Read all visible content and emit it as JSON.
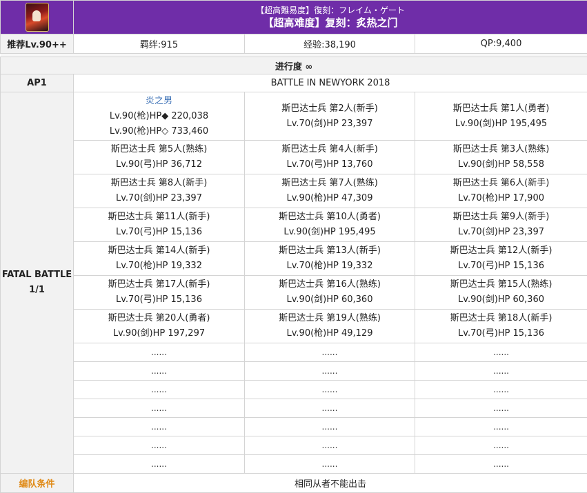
{
  "quest": {
    "title_jp": "【超高難易度】復刻：フレイム・ゲート",
    "title_cn": "【超高难度】复刻：炙热之门",
    "portrait_icon": "servant-portrait-icon"
  },
  "rewards": {
    "recommend_label": "推荐Lv.90++",
    "bond": "羁绊:915",
    "exp": "经验:38,190",
    "qp": "QP:9,400"
  },
  "progress": "进行度 ∞",
  "ap_label": "AP1",
  "stage_name": "BATTLE IN NEWYORK 2018",
  "battle_label": "FATAL BATTLE\n1/1",
  "battle_label_line1": "FATAL BATTLE",
  "battle_label_line2": "1/1",
  "enemies": [
    [
      {
        "name": "炎之男",
        "lines": [
          "Lv.90(枪)HP◆ 220,038",
          "Lv.90(枪)HP◇ 733,460"
        ],
        "boss": true
      },
      {
        "name": "斯巴达士兵 第2人(新手)",
        "lines": [
          "Lv.70(剑)HP 23,397"
        ]
      },
      {
        "name": "斯巴达士兵 第1人(勇者)",
        "lines": [
          "Lv.90(剑)HP 195,495"
        ]
      }
    ],
    [
      {
        "name": "斯巴达士兵 第5人(熟练)",
        "lines": [
          "Lv.90(弓)HP 36,712"
        ]
      },
      {
        "name": "斯巴达士兵 第4人(新手)",
        "lines": [
          "Lv.70(弓)HP 13,760"
        ]
      },
      {
        "name": "斯巴达士兵 第3人(熟练)",
        "lines": [
          "Lv.90(剑)HP 58,558"
        ]
      }
    ],
    [
      {
        "name": "斯巴达士兵 第8人(新手)",
        "lines": [
          "Lv.70(剑)HP 23,397"
        ]
      },
      {
        "name": "斯巴达士兵 第7人(熟练)",
        "lines": [
          "Lv.90(枪)HP 47,309"
        ]
      },
      {
        "name": "斯巴达士兵 第6人(新手)",
        "lines": [
          "Lv.70(枪)HP 17,900"
        ]
      }
    ],
    [
      {
        "name": "斯巴达士兵 第11人(新手)",
        "lines": [
          "Lv.70(弓)HP 15,136"
        ]
      },
      {
        "name": "斯巴达士兵 第10人(勇者)",
        "lines": [
          "Lv.90(剑)HP 195,495"
        ]
      },
      {
        "name": "斯巴达士兵 第9人(新手)",
        "lines": [
          "Lv.70(剑)HP 23,397"
        ]
      }
    ],
    [
      {
        "name": "斯巴达士兵 第14人(新手)",
        "lines": [
          "Lv.70(枪)HP 19,332"
        ]
      },
      {
        "name": "斯巴达士兵 第13人(新手)",
        "lines": [
          "Lv.70(枪)HP 19,332"
        ]
      },
      {
        "name": "斯巴达士兵 第12人(新手)",
        "lines": [
          "Lv.70(弓)HP 15,136"
        ]
      }
    ],
    [
      {
        "name": "斯巴达士兵 第17人(新手)",
        "lines": [
          "Lv.70(弓)HP 15,136"
        ]
      },
      {
        "name": "斯巴达士兵 第16人(熟练)",
        "lines": [
          "Lv.90(剑)HP 60,360"
        ]
      },
      {
        "name": "斯巴达士兵 第15人(熟练)",
        "lines": [
          "Lv.90(剑)HP 60,360"
        ]
      }
    ],
    [
      {
        "name": "斯巴达士兵 第20人(勇者)",
        "lines": [
          "Lv.90(剑)HP 197,297"
        ]
      },
      {
        "name": "斯巴达士兵 第19人(熟练)",
        "lines": [
          "Lv.90(枪)HP 49,129"
        ]
      },
      {
        "name": "斯巴达士兵 第18人(新手)",
        "lines": [
          "Lv.70(弓)HP 15,136"
        ]
      }
    ]
  ],
  "placeholder": "......",
  "placeholder_rows": 7,
  "formation_label": "编队条件",
  "formation_value": "相同从者不能出击",
  "colors": {
    "header_purple": "#6f2da8",
    "boss_name": "#3a6fb5",
    "formation_label": "#e08a16"
  }
}
